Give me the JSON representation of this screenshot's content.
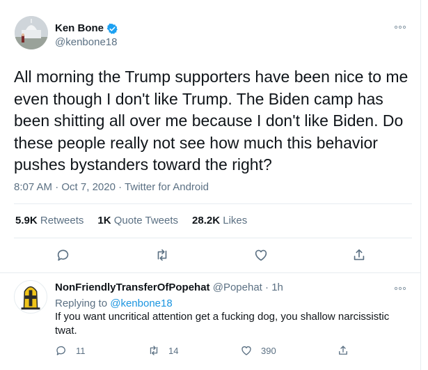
{
  "tweet": {
    "display_name": "Ken Bone",
    "handle": "@kenbone18",
    "text": "All morning the Trump supporters have been nice to me even though I don't like Trump. The Biden camp has been shitting all over me because I don't like Biden. Do these people really not see how much this behavior pushes bystanders toward the right?",
    "time": "8:07 AM",
    "date": "Oct 7, 2020",
    "source": "Twitter for Android",
    "more_icon": "more-dots-icon",
    "verified_icon": "verified-badge-icon",
    "stats": {
      "retweets_count": "5.9K",
      "retweets_label": "Retweets",
      "quotes_count": "1K",
      "quotes_label": "Quote Tweets",
      "likes_count": "28.2K",
      "likes_label": "Likes"
    },
    "actions": [
      "reply-icon",
      "retweet-icon",
      "like-icon",
      "share-icon"
    ]
  },
  "reply": {
    "display_name": "NonFriendlyTransferOfPopehat",
    "handle": "@Popehat",
    "separator": "·",
    "age": "1h",
    "replying_prefix": "Replying to",
    "replying_handle": "@kenbone18",
    "text": "If you want uncritical attention get a fucking dog, you shallow narcissistic twat.",
    "counts": {
      "replies": "11",
      "retweets": "14",
      "likes": "390"
    }
  },
  "colors": {
    "text_primary": "#0f1419",
    "text_secondary": "#5b7083",
    "link": "#1b95e0",
    "verified": "#1da1f2",
    "divider": "#e6ecf0"
  }
}
